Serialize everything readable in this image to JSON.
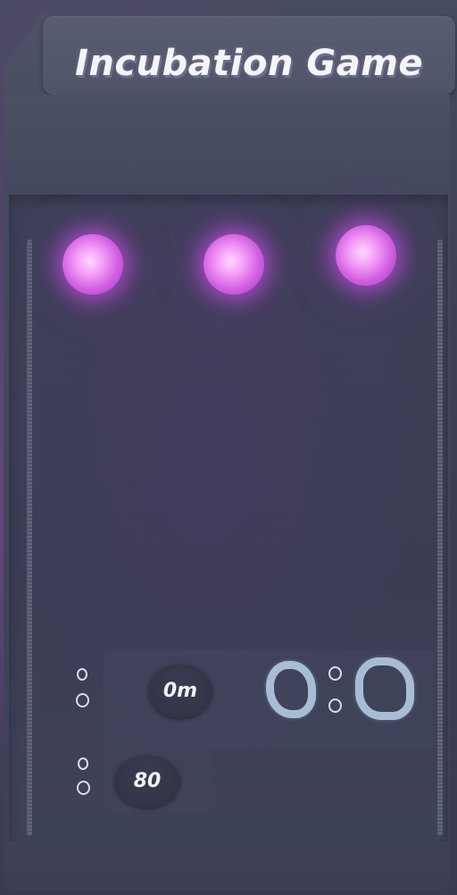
{
  "title": "Incubation Game",
  "controls": {
    "primary_button_label": "0m",
    "secondary_button_label": "80",
    "side_indicator_label": "0"
  },
  "lamps": [
    {
      "name": "lamp-1",
      "color": "#e884f0"
    },
    {
      "name": "lamp-2",
      "color": "#e884f0"
    },
    {
      "name": "lamp-3",
      "color": "#e884f0"
    }
  ],
  "colors": {
    "background": "#3a3c52",
    "title_text": "#f4f4fa",
    "lamp_glow": "#d25fe2",
    "ring_button": "#a9bcd6"
  }
}
